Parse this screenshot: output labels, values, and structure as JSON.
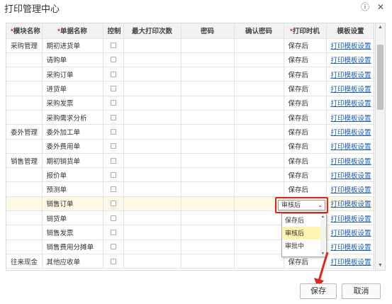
{
  "dialog": {
    "title": "打印管理中心",
    "help_icon": "help-icon",
    "close_icon": "close-icon"
  },
  "columns": [
    "模块名称",
    "单据名称",
    "控制",
    "最大打印次数",
    "密码",
    "确认密码",
    "打印时机",
    "模板设置"
  ],
  "required_columns": [
    0,
    1,
    6
  ],
  "rows": [
    {
      "module": "采购管理",
      "doc": "期初进货单",
      "timing": "保存后",
      "template": "打印模板设置"
    },
    {
      "module": "",
      "doc": "请购单",
      "timing": "保存后",
      "template": "打印模板设置"
    },
    {
      "module": "",
      "doc": "采购订单",
      "timing": "保存后",
      "template": "打印模板设置"
    },
    {
      "module": "",
      "doc": "进货单",
      "timing": "保存后",
      "template": "打印模板设置"
    },
    {
      "module": "",
      "doc": "采购发票",
      "timing": "保存后",
      "template": "打印模板设置"
    },
    {
      "module": "",
      "doc": "采购需求分析",
      "timing": "保存后",
      "template": "打印模板设置"
    },
    {
      "module": "委外管理",
      "doc": "委外加工单",
      "timing": "保存后",
      "template": "打印模板设置"
    },
    {
      "module": "",
      "doc": "委外费用单",
      "timing": "保存后",
      "template": "打印模板设置"
    },
    {
      "module": "销售管理",
      "doc": "期初销货单",
      "timing": "保存后",
      "template": "打印模板设置"
    },
    {
      "module": "",
      "doc": "报价单",
      "timing": "保存后",
      "template": "打印模板设置"
    },
    {
      "module": "",
      "doc": "预测单",
      "timing": "保存后",
      "template": "打印模板设置"
    },
    {
      "module": "",
      "doc": "销售订单",
      "timing": "",
      "template": "打印模板设置"
    },
    {
      "module": "",
      "doc": "销货单",
      "timing": "",
      "template": "打印模板设置"
    },
    {
      "module": "",
      "doc": "销售发票",
      "timing": "",
      "template": "打印模板设置"
    },
    {
      "module": "",
      "doc": "销售费用分摊单",
      "timing": "",
      "template": "打印模板设置"
    },
    {
      "module": "往来现金",
      "doc": "其他应收单",
      "timing": "保存后",
      "template": "打印模板设置"
    }
  ],
  "highlight_row": 11,
  "dropdown": {
    "row": 11,
    "selected": "审核后",
    "options": [
      "保存后",
      "审核后",
      "审批中"
    ],
    "active_option": 1
  },
  "colors": {
    "highlight": "#fdf9e4",
    "annotation": "#e0261b",
    "link": "#1a5fb4",
    "active_option": "#fff3b0"
  },
  "buttons": {
    "save": "保存",
    "cancel": "取消"
  }
}
